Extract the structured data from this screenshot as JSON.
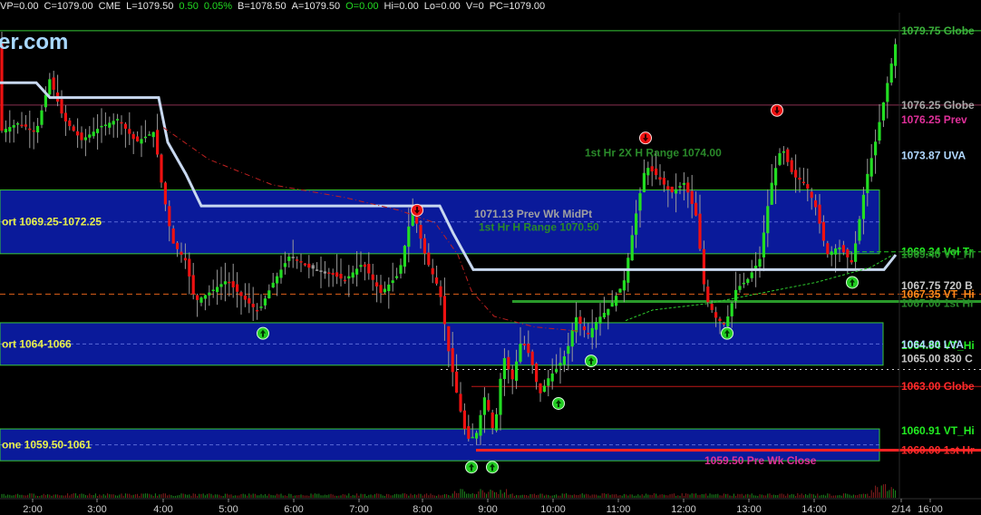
{
  "quote": {
    "items": [
      {
        "text": "VP=0.00",
        "color": "#e6e6e6"
      },
      {
        "text": "C=1079.00",
        "color": "#e6e6e6"
      },
      {
        "text": "CME",
        "color": "#e6e6e6"
      },
      {
        "text": "L=1079.50",
        "color": "#e6e6e6"
      },
      {
        "text": "0.50",
        "color": "#22dd22"
      },
      {
        "text": "0.05%",
        "color": "#22dd22"
      },
      {
        "text": "B=1078.50",
        "color": "#e6e6e6"
      },
      {
        "text": "A=1079.50",
        "color": "#e6e6e6"
      },
      {
        "text": "O=0.00",
        "color": "#22dd22"
      },
      {
        "text": "Hi=0.00",
        "color": "#e6e6e6"
      },
      {
        "text": "Lo=0.00",
        "color": "#e6e6e6"
      },
      {
        "text": "V=0",
        "color": "#e6e6e6"
      },
      {
        "text": "PC=1079.00",
        "color": "#e6e6e6"
      }
    ]
  },
  "watermark": "er.com",
  "chart_data": {
    "type": "candlestick",
    "x_ticks": [
      "2:00",
      "3:00",
      "4:00",
      "5:00",
      "6:00",
      "7:00",
      "8:00",
      "9:00",
      "10:00",
      "11:00",
      "12:00",
      "13:00",
      "14:00",
      "2/14",
      "16:00"
    ],
    "ylim": [
      1057.8,
      1080.6
    ],
    "zones": [
      {
        "label": "ort 1069.25-1072.25",
        "low": 1069.25,
        "high": 1072.25
      },
      {
        "label": "ort 1064-1066",
        "low": 1064.0,
        "high": 1066.0
      },
      {
        "label": "one 1059.50-1061",
        "low": 1059.5,
        "high": 1061.0
      }
    ],
    "annotations": [
      {
        "text": "1st Hr 2X H Range 1074.00",
        "price": 1074.0,
        "color": "#2a8a2a"
      },
      {
        "text": "1071.13  Prev Wk MidPt",
        "price": 1071.13,
        "color": "#a0a0a0"
      },
      {
        "text": "1st Hr H Range 1070.50",
        "price": 1070.5,
        "color": "#2a8a2a"
      },
      {
        "text": "1059.50  Pre Wk Close",
        "price": 1059.5,
        "color": "#e0309a"
      }
    ],
    "right_labels": [
      {
        "text": "1079.75  Globe",
        "price": 1079.75,
        "color": "#3bb23b"
      },
      {
        "text": "1076.25  Globe",
        "price": 1076.25,
        "color": "#a8a8a8"
      },
      {
        "text": "1076.25  Prev",
        "price": 1076.25,
        "color": "#e0309a"
      },
      {
        "text": "1073.87  UVA",
        "price": 1073.87,
        "color": "#b0d8ff"
      },
      {
        "text": "1069.34  Vol Tr",
        "price": 1069.34,
        "color": "#22ee22"
      },
      {
        "text": "1069.40  VT_Hi",
        "price": 1069.4,
        "color": "#2a8a2a"
      },
      {
        "text": "1067.75  720 B",
        "price": 1067.75,
        "color": "#c8c8c8"
      },
      {
        "text": "1067.35  VT_Hi",
        "price": 1067.35,
        "color": "#ff8a1a"
      },
      {
        "text": "1067.00  1st Hr",
        "price": 1067.0,
        "color": "#2a8a2a"
      },
      {
        "text": "1064.94  VT_Hi",
        "price": 1064.94,
        "color": "#22ee22"
      },
      {
        "text": "1064.80  LVA",
        "price": 1064.8,
        "color": "#b0d8ff"
      },
      {
        "text": "1065.00  830 C",
        "price": 1065.0,
        "color": "#c8c8c8"
      },
      {
        "text": "1063.00  Globe",
        "price": 1063.0,
        "color": "#ff2a2a"
      },
      {
        "text": "1060.91  VT_Hi",
        "price": 1060.91,
        "color": "#22ee22"
      },
      {
        "text": "1060.00  1st Hr",
        "price": 1060.0,
        "color": "#ff2a2a"
      }
    ],
    "colors": {
      "up": "#22dd22",
      "down": "#ee1111",
      "neutral": "#9a9a9a",
      "zone_fill": "#0a1a9a",
      "zone_border": "#37c837",
      "vwap": "#c8d8f0"
    }
  }
}
